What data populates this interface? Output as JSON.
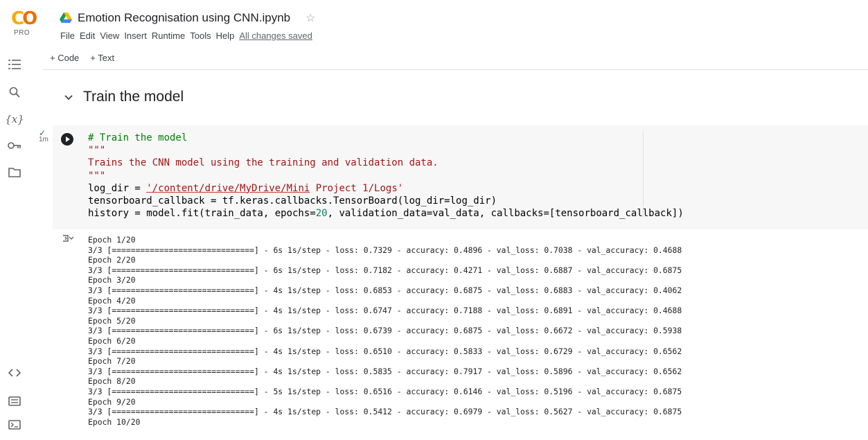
{
  "app": {
    "logo_pro": "PRO"
  },
  "notebook": {
    "title": "Emotion Recognisation using CNN.ipynb"
  },
  "menu": {
    "items": [
      "File",
      "Edit",
      "View",
      "Insert",
      "Runtime",
      "Tools",
      "Help"
    ],
    "status": "All changes saved"
  },
  "toolbar": {
    "add_code": "+ Code",
    "add_text": "+ Text"
  },
  "sidebar": {
    "icons": [
      "table-of-contents-icon",
      "search-icon",
      "variables-icon",
      "secrets-key-icon",
      "files-folder-icon",
      "code-snippets-icon",
      "command-palette-icon",
      "terminal-icon"
    ],
    "variables_label": "{x}"
  },
  "section": {
    "title": "Train the model"
  },
  "cell": {
    "status_time": "1m",
    "code": {
      "comment": "# Train the model",
      "doc_open": "\"\"\"",
      "doc_text": "Trains the CNN model using the training and validation data.",
      "doc_close": "\"\"\"",
      "line_logdir_prefix": "log_dir = ",
      "line_logdir_path_a": "'/content/drive/MyDrive/Mini",
      "line_logdir_path_b": " Project 1/Logs'",
      "line_tb": "tensorboard_callback = tf.keras.callbacks.TensorBoard(log_dir=log_dir)",
      "line_fit_a": "history = model.fit(train_data, epochs=",
      "line_fit_num": "20",
      "line_fit_b": ", validation_data=val_data, callbacks=[tensorboard_callback])"
    }
  },
  "output": {
    "lines": [
      "Epoch 1/20",
      "3/3 [==============================] - 6s 1s/step - loss: 0.7329 - accuracy: 0.4896 - val_loss: 0.7038 - val_accuracy: 0.4688",
      "Epoch 2/20",
      "3/3 [==============================] - 6s 1s/step - loss: 0.7182 - accuracy: 0.4271 - val_loss: 0.6887 - val_accuracy: 0.6875",
      "Epoch 3/20",
      "3/3 [==============================] - 4s 1s/step - loss: 0.6853 - accuracy: 0.6875 - val_loss: 0.6883 - val_accuracy: 0.4062",
      "Epoch 4/20",
      "3/3 [==============================] - 4s 1s/step - loss: 0.6747 - accuracy: 0.7188 - val_loss: 0.6891 - val_accuracy: 0.4688",
      "Epoch 5/20",
      "3/3 [==============================] - 6s 1s/step - loss: 0.6739 - accuracy: 0.6875 - val_loss: 0.6672 - val_accuracy: 0.5938",
      "Epoch 6/20",
      "3/3 [==============================] - 4s 1s/step - loss: 0.6510 - accuracy: 0.5833 - val_loss: 0.6729 - val_accuracy: 0.6562",
      "Epoch 7/20",
      "3/3 [==============================] - 4s 1s/step - loss: 0.5835 - accuracy: 0.7917 - val_loss: 0.5896 - val_accuracy: 0.6562",
      "Epoch 8/20",
      "3/3 [==============================] - 5s 1s/step - loss: 0.6516 - accuracy: 0.6146 - val_loss: 0.5196 - val_accuracy: 0.6875",
      "Epoch 9/20",
      "3/3 [==============================] - 4s 1s/step - loss: 0.5412 - accuracy: 0.6979 - val_loss: 0.5627 - val_accuracy: 0.6875",
      "Epoch 10/20"
    ]
  }
}
